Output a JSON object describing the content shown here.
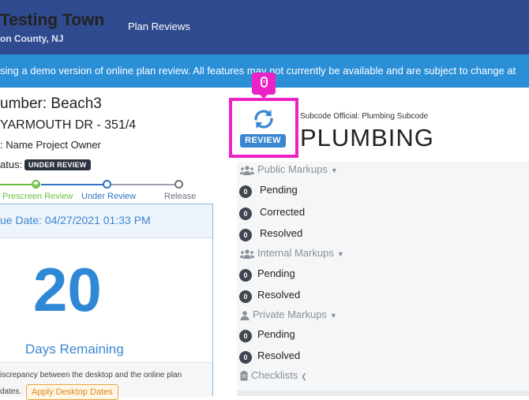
{
  "header": {
    "town": "Testing Town",
    "county": "on County, NJ",
    "nav_plan_reviews": "Plan Reviews"
  },
  "banner": {
    "text": "sing a demo version of online plan review. All features may not currently be available and are subject to change at"
  },
  "permit": {
    "number": "umber: Beach3",
    "address": "YARMOUTH DR - 351/4",
    "owner": ": Name Project Owner",
    "status_label": "atus:",
    "status_badge": "UNDER REVIEW"
  },
  "progress": {
    "steps": [
      "Prescreen Review",
      "Under Review",
      "Release"
    ]
  },
  "due": {
    "date": "ue Date: 04/27/2021 01:33 PM",
    "days": "20",
    "days_label": "Days Remaining",
    "discrepancy_1": "iscrepancy between the desktop and the online plan",
    "discrepancy_2": "dates.",
    "apply_button": "Apply Desktop Dates"
  },
  "review": {
    "badge": "REVIEW",
    "subcode_official": "Subcode Official: Plumbing Subcode",
    "subcode": "PLUMBING"
  },
  "markups": {
    "public": {
      "title": "Public Markups",
      "rows": [
        {
          "count": "0",
          "label": "Pending"
        },
        {
          "count": "0",
          "label": "Corrected"
        },
        {
          "count": "0",
          "label": "Resolved"
        }
      ]
    },
    "internal": {
      "title": "Internal Markups",
      "rows": [
        {
          "count": "0",
          "label": "Pending"
        },
        {
          "count": "0",
          "label": "Resolved"
        }
      ]
    },
    "private": {
      "title": "Private Markups",
      "rows": [
        {
          "count": "0",
          "label": "Pending"
        },
        {
          "count": "0",
          "label": "Resolved"
        }
      ]
    },
    "checklists": "Checklists"
  },
  "colors": {
    "header_bg": "#2f4a8e",
    "banner_bg": "#2b8fd8",
    "accent_blue": "#2f88d6",
    "highlight_magenta": "#ec22c4",
    "prescreen_green": "#6cbf45"
  }
}
